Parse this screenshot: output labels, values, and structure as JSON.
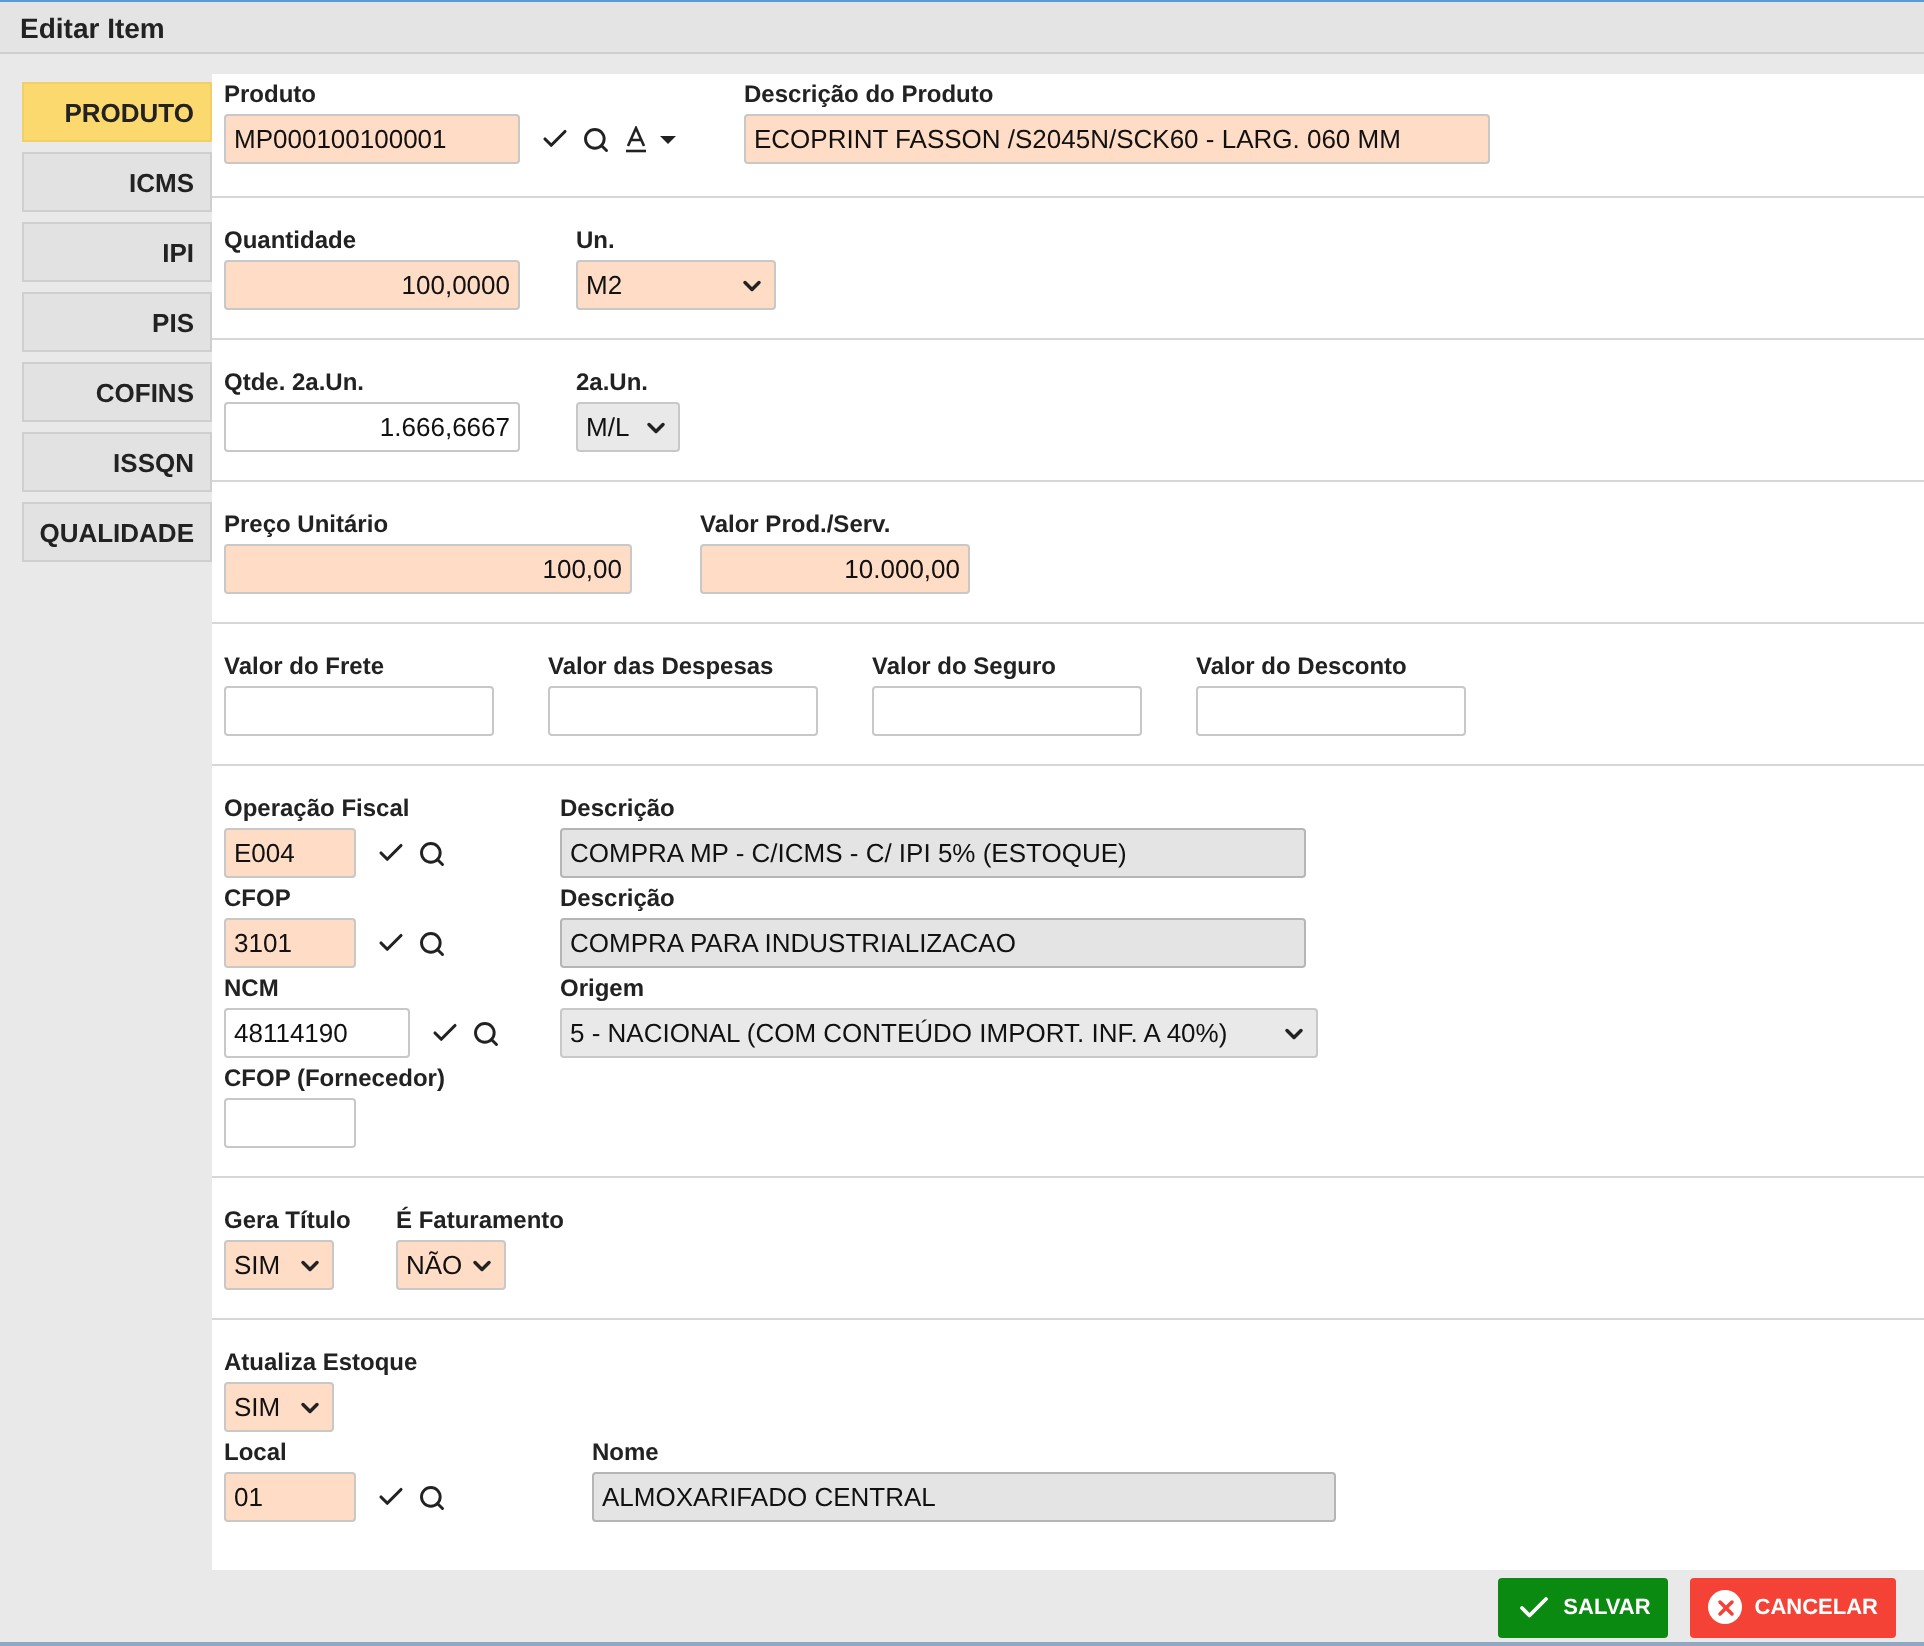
{
  "window": {
    "title": "Editar Item"
  },
  "tabs": [
    {
      "label": "PRODUTO",
      "selected": true
    },
    {
      "label": "ICMS",
      "selected": false
    },
    {
      "label": "IPI",
      "selected": false
    },
    {
      "label": "PIS",
      "selected": false
    },
    {
      "label": "COFINS",
      "selected": false
    },
    {
      "label": "ISSQN",
      "selected": false
    },
    {
      "label": "QUALIDADE",
      "selected": false
    }
  ],
  "sections": [
    {
      "rows": [
        {
          "fields": [
            {
              "label": "Produto",
              "value": "MP000100100001",
              "kind": "text",
              "required": true,
              "lookup": true,
              "format": true
            },
            {
              "label": "Descrição do Produto",
              "value": "ECOPRINT FASSON /S2045N/SCK60 - LARG. 060 MM",
              "kind": "text",
              "required": true
            }
          ]
        }
      ]
    },
    {
      "rows": [
        {
          "fields": [
            {
              "label": "Quantidade",
              "value": "100,0000",
              "kind": "number",
              "required": true
            },
            {
              "label": "Un.",
              "value": "M2",
              "kind": "select",
              "required": true
            }
          ]
        }
      ]
    },
    {
      "rows": [
        {
          "fields": [
            {
              "label": "Qtde. 2a.Un.",
              "value": "1.666,6667",
              "kind": "number",
              "required": false
            },
            {
              "label": "2a.Un.",
              "value": "M/L",
              "kind": "select",
              "required": false
            }
          ]
        }
      ]
    },
    {
      "rows": [
        {
          "fields": [
            {
              "label": "Preço Unitário",
              "value": "100,00",
              "kind": "number",
              "required": true
            },
            {
              "label": "Valor Prod./Serv.",
              "value": "10.000,00",
              "kind": "number",
              "required": true
            }
          ]
        }
      ]
    },
    {
      "rows": [
        {
          "fields": [
            {
              "label": "Valor do Frete",
              "kind": "number",
              "required": false
            },
            {
              "label": "Valor das Despesas",
              "kind": "number",
              "required": false
            },
            {
              "label": "Valor do Seguro",
              "kind": "number",
              "required": false
            },
            {
              "label": "Valor do Desconto",
              "kind": "number",
              "required": false
            }
          ]
        }
      ]
    },
    {
      "rows": [
        {
          "fields": [
            {
              "label": "Operação Fiscal",
              "value": "E004",
              "kind": "text",
              "required": true,
              "lookup": true
            },
            {
              "label": "Descrição",
              "value": "COMPRA MP - C/ICMS - C/ IPI 5% (ESTOQUE)",
              "kind": "readonly",
              "required": false
            }
          ]
        },
        {
          "fields": [
            {
              "label": "CFOP",
              "value": "3101",
              "kind": "text",
              "required": true,
              "lookup": true
            },
            {
              "label": "Descrição",
              "value": "COMPRA PARA INDUSTRIALIZACAO",
              "kind": "readonly",
              "required": false
            }
          ]
        },
        {
          "fields": [
            {
              "label": "NCM",
              "value": "48114190",
              "kind": "text",
              "required": false,
              "lookup": true
            },
            {
              "label": "Origem",
              "value": "5 - NACIONAL (COM CONTEÚDO IMPORT. INF. A 40%)",
              "kind": "select",
              "required": false
            }
          ]
        },
        {
          "fields": [
            {
              "label": "CFOP (Fornecedor)",
              "kind": "text",
              "required": false
            }
          ]
        }
      ]
    },
    {
      "rows": [
        {
          "fields": [
            {
              "label": "Gera Título",
              "value": "SIM",
              "kind": "select",
              "required": true
            },
            {
              "label": "É Faturamento",
              "value": "NÃO",
              "kind": "select",
              "required": true
            }
          ]
        }
      ]
    },
    {
      "rows": [
        {
          "fields": [
            {
              "label": "Atualiza Estoque",
              "value": "SIM",
              "kind": "select",
              "required": true
            }
          ]
        },
        {
          "fields": [
            {
              "label": "Local",
              "value": "01",
              "kind": "text",
              "required": true,
              "lookup": true
            },
            {
              "label": "Nome",
              "value": "ALMOXARIFADO CENTRAL",
              "kind": "readonly",
              "required": false
            }
          ]
        }
      ]
    }
  ],
  "buttons": [
    {
      "label": "SALVAR",
      "kind": "save"
    },
    {
      "label": "CANCELAR",
      "kind": "cancel"
    }
  ]
}
